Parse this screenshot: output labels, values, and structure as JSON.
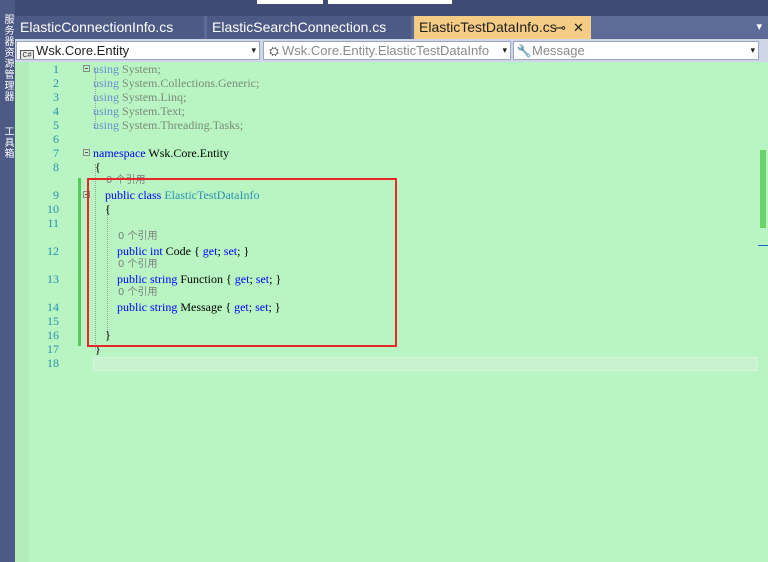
{
  "side_tabs": [
    {
      "label": "服务器资源管理器"
    },
    {
      "label": "工具箱"
    }
  ],
  "tabs": [
    {
      "label": "ElasticConnectionInfo.cs",
      "active": false
    },
    {
      "label": "ElasticSearchConnection.cs",
      "active": false
    },
    {
      "label": "ElasticTestDataInfo.cs",
      "active": true,
      "pin": "⊸",
      "close": "✕"
    }
  ],
  "tab_overflow_icon": "▾",
  "navbar": {
    "project": {
      "icon": "C#",
      "label": "Wsk.Core.Entity",
      "arrow": "▾"
    },
    "type": {
      "icon": "class-icon",
      "glyph": "⛭",
      "label": "Wsk.Core.Entity.ElasticTestDataInfo",
      "arrow": "▾"
    },
    "member": {
      "icon": "wrench-icon",
      "glyph": "🔧",
      "label": "Message",
      "arrow": "▾"
    }
  },
  "code": {
    "lines": [
      {
        "n": "1",
        "lens": null,
        "tokens": [
          [
            "kw-dim",
            "using"
          ],
          [
            "plain-dim",
            " System;"
          ]
        ]
      },
      {
        "n": "2",
        "lens": null,
        "tokens": [
          [
            "kw-dim",
            "using"
          ],
          [
            "plain-dim",
            " System.Collections.Generic;"
          ]
        ]
      },
      {
        "n": "3",
        "lens": null,
        "tokens": [
          [
            "kw-dim",
            "using"
          ],
          [
            "plain-dim",
            " System.Linq;"
          ]
        ]
      },
      {
        "n": "4",
        "lens": null,
        "tokens": [
          [
            "kw-dim",
            "using"
          ],
          [
            "plain-dim",
            " System.Text;"
          ]
        ]
      },
      {
        "n": "5",
        "lens": null,
        "tokens": [
          [
            "kw-dim",
            "using"
          ],
          [
            "plain-dim",
            " System.Threading.Tasks;"
          ]
        ]
      },
      {
        "n": "6",
        "lens": null,
        "tokens": []
      },
      {
        "n": "7",
        "lens": null,
        "tokens": [
          [
            "kw",
            "namespace"
          ],
          [
            "plain",
            " Wsk.Core.Entity"
          ]
        ]
      },
      {
        "n": "8",
        "lens": null,
        "tokens": [
          [
            "plain",
            "{"
          ]
        ]
      },
      {
        "n": "9",
        "lens": "0 个引用",
        "tokens": [
          [
            "kw",
            "public class "
          ],
          [
            "type",
            "ElasticTestDataInfo"
          ]
        ]
      },
      {
        "n": "10",
        "lens": null,
        "tokens": [
          [
            "plain",
            "{"
          ]
        ]
      },
      {
        "n": "11",
        "lens": null,
        "tokens": []
      },
      {
        "n": "12",
        "lens": "0 个引用",
        "tokens": [
          [
            "kw",
            "public int "
          ],
          [
            "plain",
            "Code { "
          ],
          [
            "kw",
            "get"
          ],
          [
            "plain",
            "; "
          ],
          [
            "kw",
            "set"
          ],
          [
            "plain",
            "; }"
          ]
        ]
      },
      {
        "n": "13",
        "lens": "0 个引用",
        "tokens": [
          [
            "kw",
            "public string "
          ],
          [
            "plain",
            "Function { "
          ],
          [
            "kw",
            "get"
          ],
          [
            "plain",
            "; "
          ],
          [
            "kw",
            "set"
          ],
          [
            "plain",
            "; }"
          ]
        ]
      },
      {
        "n": "14",
        "lens": "0 个引用",
        "tokens": [
          [
            "kw",
            "public string "
          ],
          [
            "plain",
            "Message { "
          ],
          [
            "kw",
            "get"
          ],
          [
            "plain",
            "; "
          ],
          [
            "kw",
            "set"
          ],
          [
            "plain",
            "; }"
          ]
        ]
      },
      {
        "n": "15",
        "lens": null,
        "tokens": []
      },
      {
        "n": "16",
        "lens": null,
        "tokens": [
          [
            "plain",
            "}"
          ]
        ]
      },
      {
        "n": "17",
        "lens": null,
        "tokens": [
          [
            "plain",
            "}"
          ]
        ]
      },
      {
        "n": "18",
        "lens": null,
        "tokens": []
      }
    ]
  },
  "colors": {
    "editor_bg": "#b8f5c2",
    "active_tab": "#f5cc84",
    "highlight_box": "#e8282a",
    "line_number": "#2b91af"
  }
}
